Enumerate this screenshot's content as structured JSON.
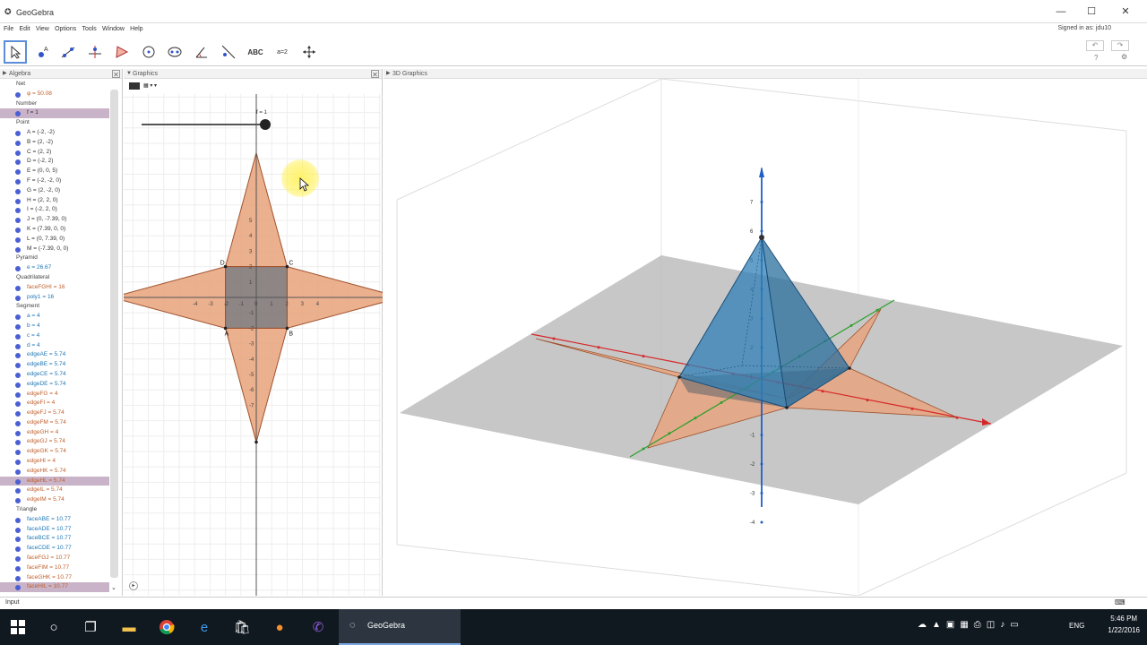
{
  "window": {
    "title": "GeoGebra"
  },
  "menu": {
    "items": [
      "File",
      "Edit",
      "View",
      "Options",
      "Tools",
      "Window",
      "Help"
    ],
    "signed_in": "Signed in as: jdu10"
  },
  "toolbar": {
    "text_tool": "ABC",
    "slider_tool": "a=2",
    "right_help": "?",
    "right_settings": "⚙"
  },
  "algebra": {
    "title": "Algebra",
    "rows": [
      {
        "kind": "cat",
        "text": "Net"
      },
      {
        "kind": "item",
        "text": "φ = 50.08",
        "color": "#c0602c"
      },
      {
        "kind": "cat",
        "text": "Number"
      },
      {
        "kind": "item",
        "text": "f = 1",
        "color": "#333",
        "sel": true
      },
      {
        "kind": "cat",
        "text": "Point"
      },
      {
        "kind": "item",
        "text": "A = (-2, -2)",
        "color": "#333"
      },
      {
        "kind": "item",
        "text": "B = (2, -2)",
        "color": "#333"
      },
      {
        "kind": "item",
        "text": "C = (2, 2)",
        "color": "#333"
      },
      {
        "kind": "item",
        "text": "D = (-2, 2)",
        "color": "#333"
      },
      {
        "kind": "item",
        "text": "E = (0, 0, 5)",
        "color": "#333"
      },
      {
        "kind": "item",
        "text": "F = (-2, -2, 0)",
        "color": "#333"
      },
      {
        "kind": "item",
        "text": "G = (2, -2, 0)",
        "color": "#333"
      },
      {
        "kind": "item",
        "text": "H = (2, 2, 0)",
        "color": "#333"
      },
      {
        "kind": "item",
        "text": "I = (-2, 2, 0)",
        "color": "#333"
      },
      {
        "kind": "item",
        "text": "J = (0, -7.39, 0)",
        "color": "#333"
      },
      {
        "kind": "item",
        "text": "K = (7.39, 0, 0)",
        "color": "#333"
      },
      {
        "kind": "item",
        "text": "L = (0, 7.39, 0)",
        "color": "#333"
      },
      {
        "kind": "item",
        "text": "M = (-7.39, 0, 0)",
        "color": "#333"
      },
      {
        "kind": "cat",
        "text": "Pyramid"
      },
      {
        "kind": "item",
        "text": "e = 26.67",
        "color": "#1f77b4"
      },
      {
        "kind": "cat",
        "text": "Quadrilateral"
      },
      {
        "kind": "item",
        "text": "faceFGHI = 16",
        "color": "#c0602c"
      },
      {
        "kind": "item",
        "text": "poly1 = 16",
        "color": "#1f77b4"
      },
      {
        "kind": "cat",
        "text": "Segment"
      },
      {
        "kind": "item",
        "text": "a = 4",
        "color": "#1f77b4"
      },
      {
        "kind": "item",
        "text": "b = 4",
        "color": "#1f77b4"
      },
      {
        "kind": "item",
        "text": "c = 4",
        "color": "#1f77b4"
      },
      {
        "kind": "item",
        "text": "d = 4",
        "color": "#1f77b4"
      },
      {
        "kind": "item",
        "text": "edgeAE = 5.74",
        "color": "#1f77b4"
      },
      {
        "kind": "item",
        "text": "edgeBE = 5.74",
        "color": "#1f77b4"
      },
      {
        "kind": "item",
        "text": "edgeCE = 5.74",
        "color": "#1f77b4"
      },
      {
        "kind": "item",
        "text": "edgeDE = 5.74",
        "color": "#1f77b4"
      },
      {
        "kind": "item",
        "text": "edgeFG = 4",
        "color": "#c0602c"
      },
      {
        "kind": "item",
        "text": "edgeFI = 4",
        "color": "#c0602c"
      },
      {
        "kind": "item",
        "text": "edgeFJ = 5.74",
        "color": "#c0602c"
      },
      {
        "kind": "item",
        "text": "edgeFM = 5.74",
        "color": "#c0602c"
      },
      {
        "kind": "item",
        "text": "edgeGH = 4",
        "color": "#c0602c"
      },
      {
        "kind": "item",
        "text": "edgeGJ = 5.74",
        "color": "#c0602c"
      },
      {
        "kind": "item",
        "text": "edgeGK = 5.74",
        "color": "#c0602c"
      },
      {
        "kind": "item",
        "text": "edgeHI = 4",
        "color": "#c0602c"
      },
      {
        "kind": "item",
        "text": "edgeHK = 5.74",
        "color": "#c0602c"
      },
      {
        "kind": "item",
        "text": "edgeHL = 5.74",
        "color": "#c0602c",
        "sel": true
      },
      {
        "kind": "item",
        "text": "edgeIL = 5.74",
        "color": "#c0602c"
      },
      {
        "kind": "item",
        "text": "edgeIM = 5.74",
        "color": "#c0602c"
      },
      {
        "kind": "cat",
        "text": "Triangle"
      },
      {
        "kind": "item",
        "text": "faceABE = 10.77",
        "color": "#1f77b4"
      },
      {
        "kind": "item",
        "text": "faceADE = 10.77",
        "color": "#1f77b4"
      },
      {
        "kind": "item",
        "text": "faceBCE = 10.77",
        "color": "#1f77b4"
      },
      {
        "kind": "item",
        "text": "faceCDE = 10.77",
        "color": "#1f77b4"
      },
      {
        "kind": "item",
        "text": "faceFGJ = 10.77",
        "color": "#c0602c"
      },
      {
        "kind": "item",
        "text": "faceFIM = 10.77",
        "color": "#c0602c"
      },
      {
        "kind": "item",
        "text": "faceGHK = 10.77",
        "color": "#c0602c"
      },
      {
        "kind": "item",
        "text": "faceHIL = 10.77",
        "color": "#c0602c",
        "sel": true
      }
    ]
  },
  "graphics": {
    "title": "Graphics",
    "slider_label": "f = 1",
    "x_ticks": [
      "-4",
      "-3",
      "-2",
      "-1",
      "0",
      "1",
      "2",
      "3",
      "4"
    ],
    "y_ticks": [
      "5",
      "4",
      "3",
      "2",
      "1",
      "-1",
      "-2",
      "-3",
      "-4",
      "-5",
      "-6",
      "-7"
    ],
    "labels": {
      "A": "A",
      "B": "B",
      "C": "C",
      "D": "D"
    }
  },
  "graphics3d": {
    "title": "3D Graphics",
    "z_ticks": [
      "7",
      "6",
      "5",
      "4",
      "3",
      "2",
      "1",
      "-1",
      "-2",
      "-3",
      "-4"
    ]
  },
  "input_bar": {
    "label": "Input"
  },
  "taskbar": {
    "app_label": "GeoGebra",
    "lang": "ENG",
    "time": "5:46 PM",
    "date": "1/22/2016"
  },
  "colors": {
    "net_fill": "#e8a27a",
    "net_stroke": "#a0522d",
    "square_fill": "#7a7070",
    "pyramid_fill": "#2f7fb5",
    "axis_red": "#d62728",
    "axis_green": "#2ca02c",
    "axis_blue": "#1f5fc8"
  }
}
